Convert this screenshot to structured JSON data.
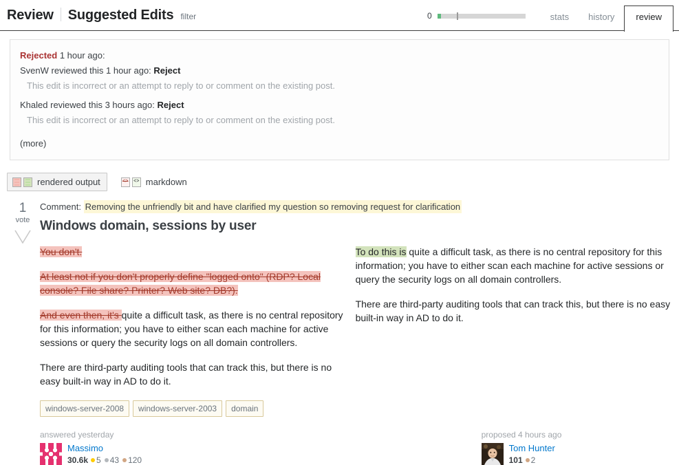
{
  "header": {
    "title": "Review",
    "section": "Suggested Edits",
    "filter_label": "filter",
    "progress_count": "0",
    "tabs": [
      {
        "label": "stats",
        "active": false
      },
      {
        "label": "history",
        "active": false
      },
      {
        "label": "review",
        "active": true
      }
    ]
  },
  "rejection": {
    "status": "Rejected",
    "status_time": "1 hour ago:",
    "reviews": [
      {
        "user": "SvenW",
        "action_prefix": "reviewed this 1 hour ago:",
        "action": "Reject",
        "reason": "This edit is incorrect or an attempt to reply to or comment on the existing post."
      },
      {
        "user": "Khaled",
        "action_prefix": "reviewed this 3 hours ago:",
        "action": "Reject",
        "reason": "This edit is incorrect or an attempt to reply to or comment on the existing post."
      }
    ],
    "more_label": "(more)"
  },
  "view_toggle": {
    "rendered_label": "rendered output",
    "markdown_label": "markdown",
    "code_glyph": "<>"
  },
  "post": {
    "vote_count": "1",
    "vote_label": "vote",
    "comment_label": "Comment:",
    "comment_text": "Removing the unfriendly bit and have clarified my question so removing request for clarification",
    "title": "Windows domain, sessions by user",
    "left": {
      "p1_del": "You don't.",
      "p2_del": "At least not if you don't properly define \"logged onto\" (RDP? Local console? File share? Printer? Web site? DB?).",
      "p3_del": "And even then, it's ",
      "p3_rest": "quite a difficult task, as there is no central repository for this information; you have to either scan each machine for active sessions or query the security logs on all domain controllers.",
      "p4": "There are third-party auditing tools that can track this, but there is no easy built-in way in AD to do it."
    },
    "right": {
      "p1_ins": "To do this is",
      "p1_rest": " quite a difficult task, as there is no central repository for this information; you have to either scan each machine for active sessions or query the security logs on all domain controllers.",
      "p2": "There are third-party auditing tools that can track this, but there is no easy built-in way in AD to do it."
    },
    "tags": [
      "windows-server-2008",
      "windows-server-2003",
      "domain"
    ],
    "author": {
      "action": "answered yesterday",
      "name": "Massimo",
      "reputation": "30.6k",
      "badges": [
        {
          "type": "gold",
          "count": "5"
        },
        {
          "type": "silver",
          "count": "43"
        },
        {
          "type": "bronze",
          "count": "120"
        }
      ]
    },
    "proposer": {
      "action": "proposed 4 hours ago",
      "name": "Tom Hunter",
      "reputation": "101",
      "badges": [
        {
          "type": "bronze",
          "count": "2"
        }
      ]
    }
  },
  "colors": {
    "deletion_bg": "#f4c3bd",
    "deletion_text": "#a33a2b",
    "insertion_bg": "#d3e3bc",
    "comment_highlight": "#fdf7d7",
    "reject_status": "#aa3333",
    "link": "#0077cc",
    "progress_green": "#5eba7d"
  }
}
